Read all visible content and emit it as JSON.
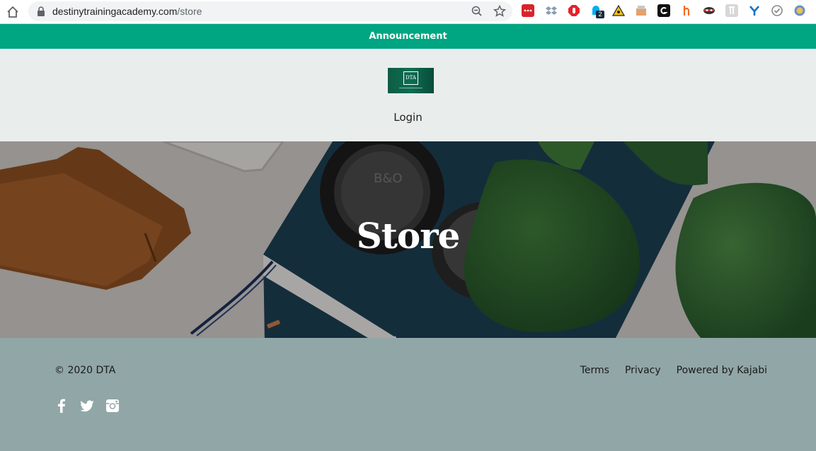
{
  "browser": {
    "url_domain": "destinytrainingacademy.com",
    "url_path": "/store",
    "extension_badge": "2"
  },
  "announcement": {
    "text": "Announcement",
    "bg_color": "#00a582"
  },
  "header": {
    "logo_text": "DTA",
    "login_label": "Login"
  },
  "hero": {
    "title": "Store"
  },
  "footer": {
    "copyright": "© 2020 DTA",
    "links": [
      "Terms",
      "Privacy",
      "Powered by Kajabi"
    ],
    "social_icons": [
      "facebook-icon",
      "twitter-icon",
      "instagram-icon"
    ],
    "bg_color": "#91a6a7"
  }
}
